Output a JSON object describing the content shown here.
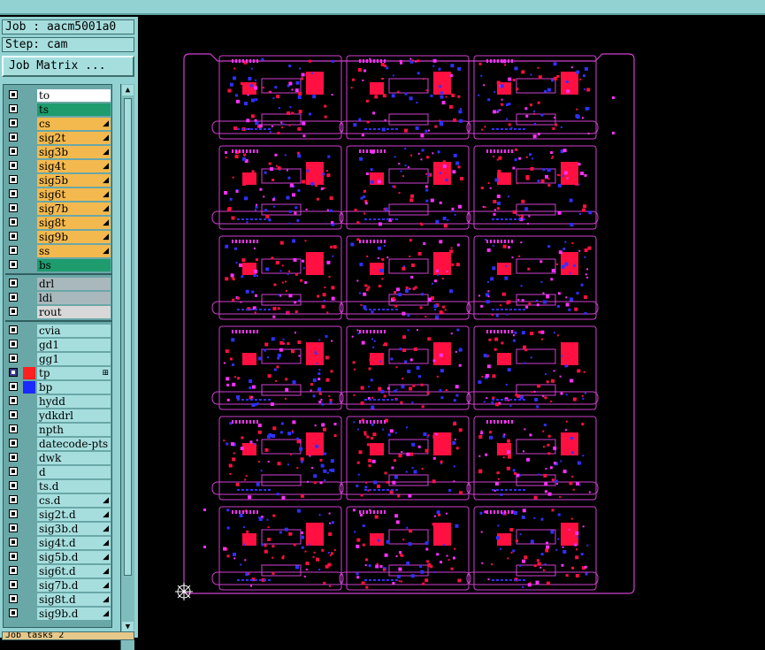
{
  "job_label": "Job : aacm5001a0",
  "step_label": "Step: cam",
  "job_matrix_label": "Job Matrix ...",
  "bottom_label": "Job tasks 2",
  "colors": {
    "panel_bg": "#93d2d2",
    "board_outline": "#d040d0",
    "copper_red": "#ff1040",
    "pad_blue": "#3030ff",
    "pad_magenta": "#ff30ff",
    "canvas_bg": "#000000"
  },
  "layers": [
    {
      "name": "to",
      "color": "#ffffff",
      "group": 1
    },
    {
      "name": "ts",
      "color": "#1e9c6e",
      "group": 1
    },
    {
      "name": "cs",
      "color": "#f4b94e",
      "group": 1,
      "mark": "◢"
    },
    {
      "name": "sig2t",
      "color": "#f4b94e",
      "group": 1,
      "mark": "◢"
    },
    {
      "name": "sig3b",
      "color": "#f4b94e",
      "group": 1,
      "mark": "◢"
    },
    {
      "name": "sig4t",
      "color": "#f4b94e",
      "group": 1,
      "mark": "◢"
    },
    {
      "name": "sig5b",
      "color": "#f4b94e",
      "group": 1,
      "mark": "◢"
    },
    {
      "name": "sig6t",
      "color": "#f4b94e",
      "group": 1,
      "mark": "◢"
    },
    {
      "name": "sig7b",
      "color": "#f4b94e",
      "group": 1,
      "mark": "◢"
    },
    {
      "name": "sig8t",
      "color": "#f4b94e",
      "group": 1,
      "mark": "◢"
    },
    {
      "name": "sig9b",
      "color": "#f4b94e",
      "group": 1,
      "mark": "◢"
    },
    {
      "name": "ss",
      "color": "#f4b94e",
      "group": 1,
      "mark": "◢"
    },
    {
      "name": "bs",
      "color": "#1e9c6e",
      "group": 1
    },
    {
      "name": "drl",
      "color": "#a9b8bc",
      "group": 2
    },
    {
      "name": "ldi",
      "color": "#a9b8bc",
      "group": 2
    },
    {
      "name": "rout",
      "color": "#d8d8d8",
      "group": 2
    },
    {
      "name": "cvia",
      "color": "#a6dede",
      "group": 3
    },
    {
      "name": "gd1",
      "color": "#a6dede",
      "group": 3
    },
    {
      "name": "gg1",
      "color": "#a6dede",
      "group": 3
    },
    {
      "name": "tp",
      "color": "#a6dede",
      "group": 3,
      "swatch": "#ff2020",
      "selected": true,
      "mark": "⊞"
    },
    {
      "name": "bp",
      "color": "#a6dede",
      "group": 3,
      "swatch": "#1a2aff"
    },
    {
      "name": "hydd",
      "color": "#a6dede",
      "group": 3
    },
    {
      "name": "ydkdrl",
      "color": "#a6dede",
      "group": 3
    },
    {
      "name": "npth",
      "color": "#a6dede",
      "group": 3
    },
    {
      "name": "datecode-pts",
      "color": "#a6dede",
      "group": 3
    },
    {
      "name": "dwk",
      "color": "#a6dede",
      "group": 3
    },
    {
      "name": "d",
      "color": "#a6dede",
      "group": 3
    },
    {
      "name": "ts.d",
      "color": "#a6dede",
      "group": 3
    },
    {
      "name": "cs.d",
      "color": "#a6dede",
      "group": 3,
      "mark": "◢"
    },
    {
      "name": "sig2t.d",
      "color": "#a6dede",
      "group": 3,
      "mark": "◢"
    },
    {
      "name": "sig3b.d",
      "color": "#a6dede",
      "group": 3,
      "mark": "◢"
    },
    {
      "name": "sig4t.d",
      "color": "#a6dede",
      "group": 3,
      "mark": "◢"
    },
    {
      "name": "sig5b.d",
      "color": "#a6dede",
      "group": 3,
      "mark": "◢"
    },
    {
      "name": "sig6t.d",
      "color": "#a6dede",
      "group": 3,
      "mark": "◢"
    },
    {
      "name": "sig7b.d",
      "color": "#a6dede",
      "group": 3,
      "mark": "◢"
    },
    {
      "name": "sig8t.d",
      "color": "#a6dede",
      "group": 3,
      "mark": "◢"
    },
    {
      "name": "sig9b.d",
      "color": "#a6dede",
      "group": 3,
      "mark": "◢"
    }
  ],
  "panel_grid": {
    "rows": 6,
    "cols": 3
  }
}
